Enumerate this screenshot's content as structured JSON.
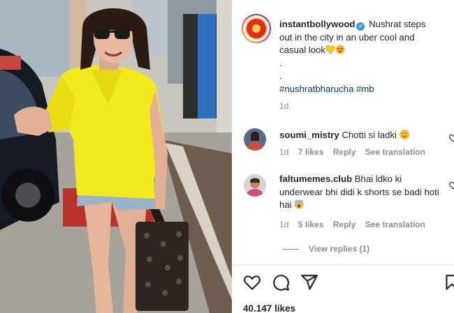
{
  "post": {
    "username": "instantbollywood",
    "caption_line1": "Nushrat steps",
    "caption_line2": "out in the city in an uber cool and",
    "caption_line3": "casual look",
    "caption_dot1": ".",
    "caption_dot2": ".",
    "hashtags": "#nushratbharucha #mb",
    "time": "1d",
    "likes": "40.147 likes"
  },
  "comments": [
    {
      "username": "soumi_mistry",
      "text": "Chotti si ladki",
      "time": "1d",
      "likes": "7 likes",
      "reply": "Reply",
      "translate": "See translation"
    },
    {
      "username": "faltumemes.club",
      "text": "Bhai ldko ki underwear bhi didi k shorts se badi hoti hai",
      "time": "1d",
      "likes": "5 likes",
      "reply": "Reply",
      "translate": "See translation"
    }
  ],
  "view_replies": "View replies (1)",
  "icons": {
    "like": "heart-icon",
    "comment": "comment-icon",
    "share": "share-icon",
    "save": "bookmark-icon"
  },
  "colors": {
    "link": "#00376b",
    "muted": "#8e8e8e",
    "verified": "#3897f0",
    "shirt": "#f2ea1c"
  }
}
